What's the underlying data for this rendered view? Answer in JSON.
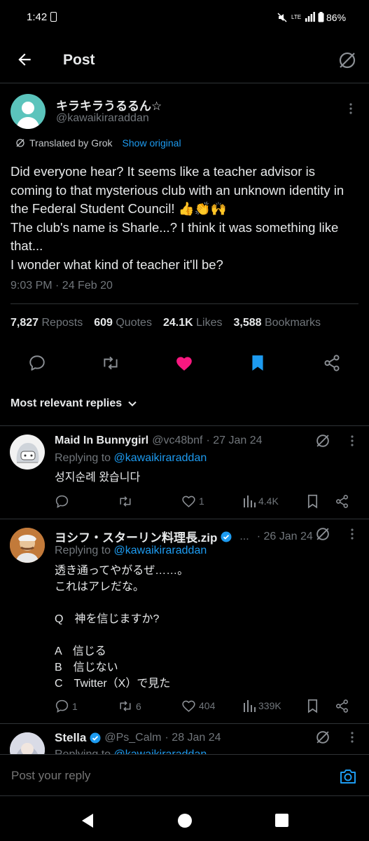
{
  "status_bar": {
    "time": "1:42",
    "battery": "86%",
    "network": "LTE"
  },
  "header": {
    "title": "Post"
  },
  "post": {
    "display_name": "キラキラうるるん☆",
    "handle": "@kawaikiraraddan",
    "translated_label": "Translated by Grok",
    "show_original": "Show original",
    "text": "Did everyone hear? It seems like a teacher advisor is coming to that mysterious club with an unknown identity in the Federal Student Council! 👍👏🙌\nThe club's name is Sharle...? I think it was something like that...\nI wonder what kind of teacher it'll be?",
    "timestamp": "9:03 PM · 24 Feb 20",
    "stats": {
      "reposts_count": "7,827",
      "reposts_label": "Reposts",
      "quotes_count": "609",
      "quotes_label": "Quotes",
      "likes_count": "24.1K",
      "likes_label": "Likes",
      "bookmarks_count": "3,588",
      "bookmarks_label": "Bookmarks"
    }
  },
  "replies_filter": "Most relevant replies",
  "replies": [
    {
      "name": "Maid In Bunnygirl",
      "handle": "@vc48bnf",
      "date": "· 27 Jan 24",
      "replying_prefix": "Replying to",
      "replying_to": "@kawaikiraraddan",
      "text": "성지순례 왔습니다",
      "replies": "",
      "reposts": "",
      "likes": "1",
      "views": "4.4K"
    },
    {
      "name": "ヨシフ・スターリン料理長.zip",
      "handle": "...",
      "date": "· 26 Jan 24",
      "replying_prefix": "Replying to",
      "replying_to": "@kawaikiraraddan",
      "text": "透き通ってやがるぜ……。\nこれはアレだな。\n\nQ　神を信じますか?\n\nA　信じる\nB　信じない\nC　Twitter（X）で見た",
      "replies": "1",
      "reposts": "6",
      "likes": "404",
      "views": "339K"
    },
    {
      "name": "Stella",
      "handle": "@Ps_Calm",
      "date": "· 28 Jan 24",
      "replying_prefix": "Replying to",
      "replying_to": "@kawaikiraraddan"
    }
  ],
  "composer": {
    "placeholder": "Post your reply"
  },
  "colors": {
    "accent": "#1d9bf0",
    "like": "#f91880",
    "background": "#000000",
    "divider": "#2f3336"
  }
}
